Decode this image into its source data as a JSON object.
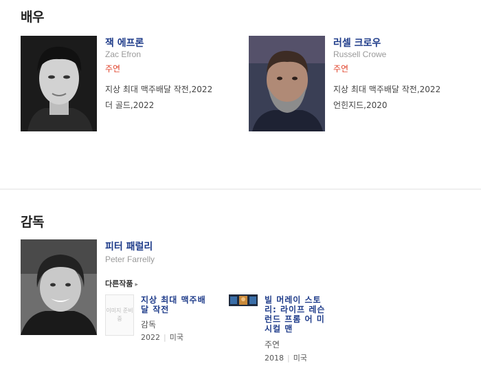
{
  "sections": {
    "actors_title": "배우",
    "director_title": "감독"
  },
  "actors": [
    {
      "name_ko": "잭 에프론",
      "name_en": "Zac Efron",
      "role": "주연",
      "works": [
        "지상 최대 맥주배달 작전,2022",
        "더 골드,2022"
      ]
    },
    {
      "name_ko": "러셀 크로우",
      "name_en": "Russell Crowe",
      "role": "주연",
      "works": [
        "지상 최대 맥주배달 작전,2022",
        "언힌지드,2020"
      ]
    }
  ],
  "director": {
    "name_ko": "피터 패럴리",
    "name_en": "Peter Farrelly",
    "other_works_label": "다른작품",
    "works": [
      {
        "image_placeholder": "이미지 준비중",
        "title_lines": [
          "지상 최대 맥주배",
          "달 작전"
        ],
        "role": "감독",
        "year": "2022",
        "country": "미국"
      },
      {
        "title_lines": [
          "빌 머레이 스토",
          "리: 라이프 레슨",
          "런드 프롬 어 미",
          "시컬 맨"
        ],
        "role": "주연",
        "year": "2018",
        "country": "미국"
      }
    ]
  }
}
